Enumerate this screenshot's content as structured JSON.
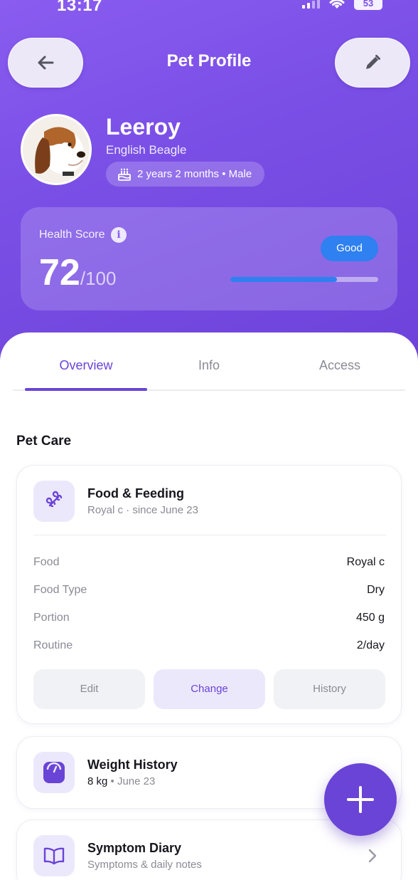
{
  "status_bar": {
    "time": "13:17",
    "battery": "53"
  },
  "header": {
    "title": "Pet Profile",
    "back_icon": "arrow-left-icon",
    "edit_icon": "pencil-icon"
  },
  "pet": {
    "name": "Leeroy",
    "breed": "English Beagle",
    "age_sex": "2 years 2 months • Male"
  },
  "health": {
    "label": "Health Score",
    "score": "72",
    "max": "/100",
    "status": "Good",
    "progress_fraction": 0.72,
    "accent_color": "#2f80f0"
  },
  "tabs": [
    {
      "label": "Overview",
      "active": true
    },
    {
      "label": "Info",
      "active": false
    },
    {
      "label": "Access",
      "active": false
    }
  ],
  "pet_care": {
    "section_title": "Pet Care",
    "food_card": {
      "title": "Food & Feeding",
      "subtitle": "Royal c · since June 23",
      "icon": "bone-icon",
      "rows": [
        {
          "label": "Food",
          "value": "Royal c"
        },
        {
          "label": "Food Type",
          "value": "Dry"
        },
        {
          "label": "Portion",
          "value": "450 g"
        },
        {
          "label": "Routine",
          "value": "2/day"
        }
      ],
      "actions": {
        "edit": "Edit",
        "change": "Change",
        "history": "History"
      }
    },
    "weight_card": {
      "title": "Weight History",
      "value": "8 kg",
      "date": " • June 23",
      "icon": "scale-icon"
    },
    "diary_card": {
      "title": "Symptom Diary",
      "subtitle": "Symptoms & daily notes",
      "icon": "book-icon"
    }
  },
  "colors": {
    "brand": "#7a4fe6",
    "accent": "#6a44d6"
  }
}
